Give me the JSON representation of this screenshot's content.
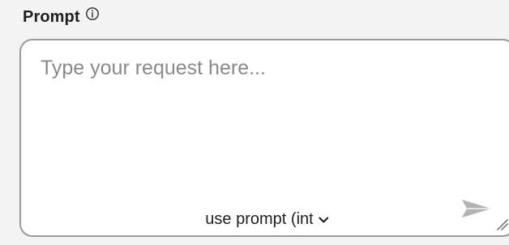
{
  "prompt": {
    "label": "Prompt",
    "info_icon": "info-circle-icon",
    "textarea": {
      "value": "",
      "placeholder": "Type your request here..."
    },
    "mode_select": {
      "selected_label": "use prompt (int",
      "chevron_icon": "chevron-down-icon"
    },
    "send_icon": "send-icon",
    "resize_icon": "resize-handle-icon"
  },
  "colors": {
    "background": "#f3f3f3",
    "border": "#9a9a9a",
    "placeholder": "#8a8a8a",
    "text": "#1f1f1f",
    "send_icon": "#b3b3b3"
  }
}
